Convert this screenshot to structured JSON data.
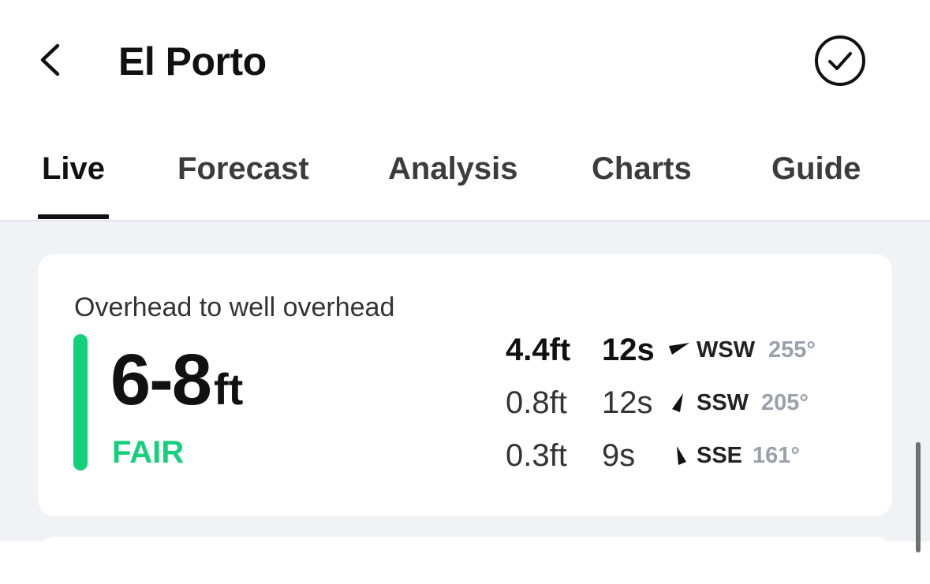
{
  "header": {
    "title": "El Porto",
    "back_icon": "chevron-left-icon",
    "check_icon": "check-circle-icon"
  },
  "tabs": [
    {
      "label": "Live",
      "active": true
    },
    {
      "label": "Forecast",
      "active": false
    },
    {
      "label": "Analysis",
      "active": false
    },
    {
      "label": "Charts",
      "active": false
    },
    {
      "label": "Guide",
      "active": false
    }
  ],
  "conditions": {
    "description": "Overhead to well overhead",
    "wave_range": "6-8",
    "wave_unit": "ft",
    "rating": "FAIR",
    "rating_color": "#14d07b"
  },
  "swells": [
    {
      "height": "4.4ft",
      "period": "12s",
      "direction": "WSW",
      "degrees": "255°",
      "primary": true
    },
    {
      "height": "0.8ft",
      "period": "12s",
      "direction": "SSW",
      "degrees": "205°",
      "primary": false
    },
    {
      "height": "0.3ft",
      "period": "9s",
      "direction": "SSE",
      "degrees": "161°",
      "primary": false
    }
  ],
  "colors": {
    "accent": "#14d07b",
    "background": "#f0f2f6",
    "muted_text": "#9aa1aa"
  }
}
